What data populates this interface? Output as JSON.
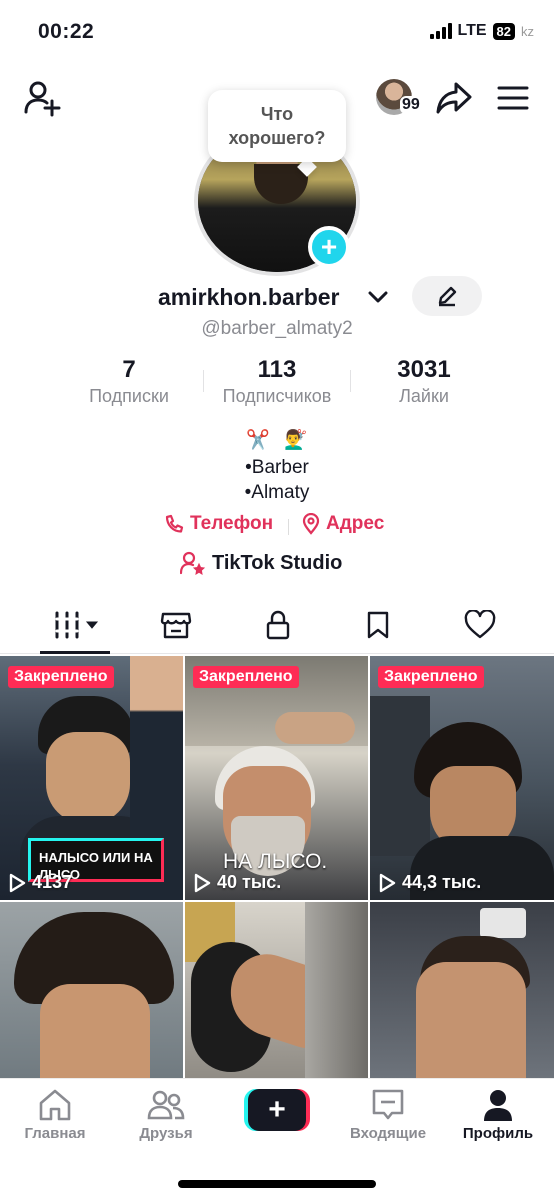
{
  "status": {
    "time": "00:22",
    "network": "LTE",
    "battery": "82",
    "watermark": "kz"
  },
  "header": {
    "friends_count": "99"
  },
  "profile": {
    "bubble_text_1": "Что",
    "bubble_text_2": "хорошего?",
    "nickname": "amirkhon.barber",
    "username": "@barber_almaty2",
    "stats": [
      {
        "value": "7",
        "label": "Подписки"
      },
      {
        "value": "113",
        "label": "Подписчиков"
      },
      {
        "value": "3031",
        "label": "Лайки"
      }
    ],
    "bio_emoji": [
      "✂️",
      "💇‍♂️"
    ],
    "bio_lines": [
      "•Barber",
      "•Almaty"
    ],
    "phone_label": "Телефон",
    "address_label": "Адрес",
    "studio_label": "TikTok Studio"
  },
  "tabs": [
    "videos-tab",
    "shop-tab",
    "private-tab",
    "saved-tab",
    "liked-tab"
  ],
  "videos": [
    {
      "pinned": "Закреплено",
      "views": "4137",
      "caption": "НАЛЫСО ИЛИ НА ЛЫСО"
    },
    {
      "pinned": "Закреплено",
      "views": "40 тыс.",
      "caption": "НА ЛЫСО."
    },
    {
      "pinned": "Закреплено",
      "views": "44,3 тыс.",
      "caption": ""
    },
    {
      "pinned": "",
      "views": "",
      "caption": ""
    },
    {
      "pinned": "",
      "views": "",
      "caption": ""
    },
    {
      "pinned": "",
      "views": "",
      "caption": ""
    }
  ],
  "nav": {
    "home": "Главная",
    "friends": "Друзья",
    "create": "+",
    "inbox": "Входящие",
    "profile": "Профиль"
  },
  "colors": {
    "accent": "#fe2c55",
    "contact": "#e0325b",
    "cyan": "#25f4ee",
    "muted": "#8a8b91"
  }
}
